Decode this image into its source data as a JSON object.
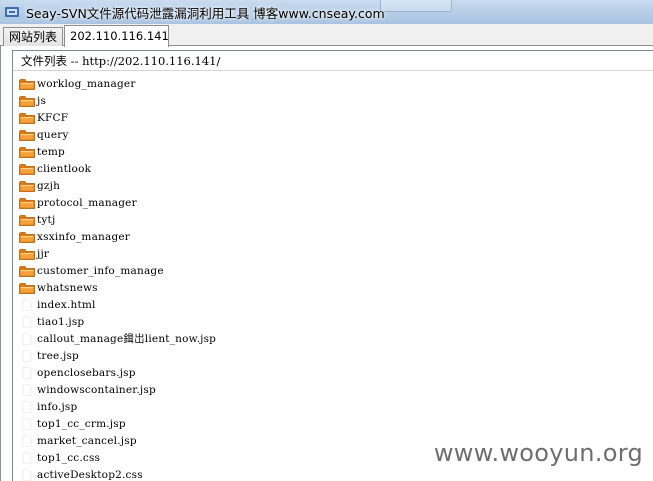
{
  "window": {
    "title": "Seay-SVN文件源代码泄露漏洞利用工具  博客www.cnseay.com"
  },
  "tabs": [
    {
      "label": "网站列表",
      "active": false
    },
    {
      "label": "202.110.116.141",
      "active": true
    }
  ],
  "file_list": {
    "header": "文件列表 -- http://202.110.116.141/",
    "items": [
      {
        "name": "worklog_manager",
        "kind": "folder"
      },
      {
        "name": "js",
        "kind": "folder"
      },
      {
        "name": "KFCF",
        "kind": "folder"
      },
      {
        "name": "query",
        "kind": "folder"
      },
      {
        "name": "temp",
        "kind": "folder"
      },
      {
        "name": "clientlook",
        "kind": "folder"
      },
      {
        "name": "gzjh",
        "kind": "folder"
      },
      {
        "name": "protocol_manager",
        "kind": "folder"
      },
      {
        "name": "tytj",
        "kind": "folder"
      },
      {
        "name": "xsxinfo_manager",
        "kind": "folder"
      },
      {
        "name": "jjr",
        "kind": "folder"
      },
      {
        "name": "customer_info_manage",
        "kind": "folder"
      },
      {
        "name": "whatsnews",
        "kind": "folder"
      },
      {
        "name": "index.html",
        "kind": "file"
      },
      {
        "name": "tiao1.jsp",
        "kind": "file"
      },
      {
        "name": "callout_manage鍓岀lient_now.jsp",
        "kind": "file"
      },
      {
        "name": "tree.jsp",
        "kind": "file"
      },
      {
        "name": "openclosebars.jsp",
        "kind": "file"
      },
      {
        "name": "windowscontainer.jsp",
        "kind": "file"
      },
      {
        "name": "info.jsp",
        "kind": "file"
      },
      {
        "name": "top1_cc_crm.jsp",
        "kind": "file"
      },
      {
        "name": "market_cancel.jsp",
        "kind": "file"
      },
      {
        "name": "top1_cc.css",
        "kind": "file"
      },
      {
        "name": "activeDesktop2.css",
        "kind": "file"
      }
    ]
  },
  "watermark": "www.wooyun.org",
  "colors": {
    "folder_icon": "#e07a10",
    "titlebar": "#b6cde7"
  }
}
